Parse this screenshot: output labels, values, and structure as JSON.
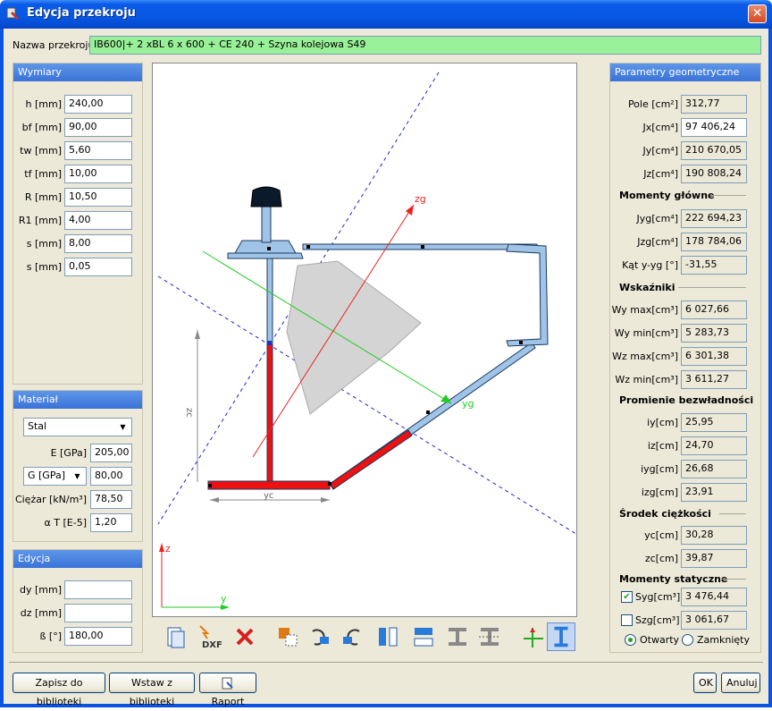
{
  "window": {
    "title": "Edycja przekroju",
    "close_glyph": "✕"
  },
  "name_row": {
    "label": "Nazwa przekroju",
    "value": "IB600|+ 2 xBL 6 x 600 + CE 240  + Szyna kolejowa S49",
    "highlight_color": "#98f098"
  },
  "dimensions": {
    "title": "Wymiary",
    "fields": [
      {
        "label": "h [mm]",
        "value": "240,00"
      },
      {
        "label": "bf [mm]",
        "value": "90,00"
      },
      {
        "label": "tw [mm]",
        "value": "5,60"
      },
      {
        "label": "tf [mm]",
        "value": "10,00"
      },
      {
        "label": "R [mm]",
        "value": "10,50"
      },
      {
        "label": "R1 [mm]",
        "value": "4,00"
      },
      {
        "label": "s [mm]",
        "value": "8,00"
      },
      {
        "label": "s [mm]",
        "value": "0,05"
      }
    ]
  },
  "material": {
    "title": "Materiał",
    "type": "Stal",
    "e_label": "E [GPa]",
    "e_value": "205,00",
    "g_combo": "G [GPa]",
    "g_value": "80,00",
    "weight_label": "Ciężar [kN/m³]",
    "weight_value": "78,50",
    "alpha_label": "α T [E-5]",
    "alpha_value": "1,20"
  },
  "edit": {
    "title": "Edycja",
    "dy_label": "dy [mm]",
    "dy_value": "",
    "dz_label": "dz [mm]",
    "dz_value": "",
    "beta_label": "ß [°]",
    "beta_value": "180,00"
  },
  "canvas": {
    "axis_z": "z",
    "axis_y": "y",
    "axis_zg": "zg",
    "axis_yg": "yg",
    "dim_zc": "zc",
    "dim_yc": "yc",
    "colors": {
      "plate_red": "#ee1111",
      "steel_blue": "#9fc4e8",
      "zone_gray": "#d4d4d4",
      "yg_green": "#22cc22",
      "zg_red": "#ee2222",
      "dash_blue": "#2222cc"
    }
  },
  "toolbar": {
    "icons": [
      "library-icon",
      "dxf-import-icon",
      "delete-icon",
      "move-icon",
      "rotate-left-icon",
      "rotate-right-icon",
      "mirror-vertical-icon",
      "mirror-horizontal-icon",
      "align-horizontal-icon",
      "align-vertical-icon",
      "axes-icon",
      "section-view-icon"
    ],
    "dxf_text": "DXF"
  },
  "geometry": {
    "title": "Parametry geometryczne",
    "basic": [
      {
        "label": "Pole [cm²]",
        "value": "312,77"
      },
      {
        "label": "Jx[cm⁴]",
        "value": "97 406,24"
      },
      {
        "label": "Jy[cm⁴]",
        "value": "210 670,05"
      },
      {
        "label": "Jz[cm⁴]",
        "value": "190 808,24"
      }
    ],
    "main_moments_title": "Momenty główne",
    "main_moments": [
      {
        "label": "Jyg[cm⁴]",
        "value": "222 694,23"
      },
      {
        "label": "Jzg[cm⁴]",
        "value": "178 784,06"
      },
      {
        "label": "Kąt y-yg [°]",
        "value": "-31,55"
      }
    ],
    "indices_title": "Wskaźniki",
    "indices": [
      {
        "label": "Wy max[cm³]",
        "value": "6 027,66"
      },
      {
        "label": "Wy min[cm³]",
        "value": "5 283,73"
      },
      {
        "label": "Wz max[cm³]",
        "value": "6 301,38"
      },
      {
        "label": "Wz min[cm³]",
        "value": "3 611,27"
      }
    ],
    "radii_title": "Promienie bezwładności",
    "radii": [
      {
        "label": "iy[cm]",
        "value": "25,95"
      },
      {
        "label": "iz[cm]",
        "value": "24,70"
      },
      {
        "label": "iyg[cm]",
        "value": "26,68"
      },
      {
        "label": "izg[cm]",
        "value": "23,91"
      }
    ],
    "center_title": "Środek ciężkości",
    "center": [
      {
        "label": "yc[cm]",
        "value": "30,28"
      },
      {
        "label": "zc[cm]",
        "value": "39,87"
      }
    ],
    "static_title": "Momenty statyczne",
    "static": [
      {
        "label": "Syg[cm³]",
        "value": "3 476,44",
        "checked": true
      },
      {
        "label": "Szg[cm³]",
        "value": "3 061,67",
        "checked": false
      }
    ],
    "radio_open": "Otwarty",
    "radio_closed": "Zamknięty"
  },
  "bottom": {
    "save_label": "Zapisz do biblioteki",
    "insert_label": "Wstaw z biblioteki",
    "report_label": "Raport",
    "ok_label": "OK",
    "cancel_label": "Anuluj"
  }
}
